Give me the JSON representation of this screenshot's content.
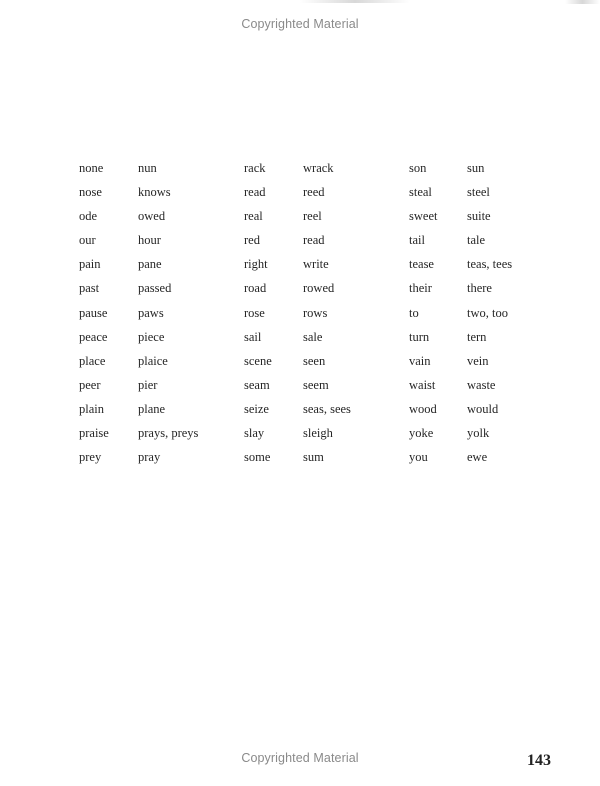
{
  "header": {
    "watermark": "Copyrighted Material"
  },
  "homophones": {
    "rows": [
      {
        "left": [
          "none",
          "nun"
        ],
        "middle": [
          "rack",
          "wrack"
        ],
        "right": [
          "son",
          "sun"
        ]
      },
      {
        "left": [
          "nose",
          "knows"
        ],
        "middle": [
          "read",
          "reed"
        ],
        "right": [
          "steal",
          "steel"
        ]
      },
      {
        "left": [
          "ode",
          "owed"
        ],
        "middle": [
          "real",
          "reel"
        ],
        "right": [
          "sweet",
          "suite"
        ]
      },
      {
        "left": [
          "our",
          "hour"
        ],
        "middle": [
          "red",
          "read"
        ],
        "right": [
          "tail",
          "tale"
        ]
      },
      {
        "left": [
          "pain",
          "pane"
        ],
        "middle": [
          "right",
          "write"
        ],
        "right": [
          "tease",
          "teas, tees"
        ]
      },
      {
        "left": [
          "past",
          "passed"
        ],
        "middle": [
          "road",
          "rowed"
        ],
        "right": [
          "their",
          "there"
        ]
      },
      {
        "left": [
          "pause",
          "paws"
        ],
        "middle": [
          "rose",
          "rows"
        ],
        "right": [
          "to",
          "two, too"
        ]
      },
      {
        "left": [
          "peace",
          "piece"
        ],
        "middle": [
          "sail",
          "sale"
        ],
        "right": [
          "turn",
          "tern"
        ]
      },
      {
        "left": [
          "place",
          "plaice"
        ],
        "middle": [
          "scene",
          "seen"
        ],
        "right": [
          "vain",
          "vein"
        ]
      },
      {
        "left": [
          "peer",
          "pier"
        ],
        "middle": [
          "seam",
          "seem"
        ],
        "right": [
          "waist",
          "waste"
        ]
      },
      {
        "left": [
          "plain",
          "plane"
        ],
        "middle": [
          "seize",
          "seas, sees"
        ],
        "right": [
          "wood",
          "would"
        ]
      },
      {
        "left": [
          "praise",
          "prays, preys"
        ],
        "middle": [
          "slay",
          "sleigh"
        ],
        "right": [
          "yoke",
          "yolk"
        ]
      },
      {
        "left": [
          "prey",
          "pray"
        ],
        "middle": [
          "some",
          "sum"
        ],
        "right": [
          "you",
          "ewe"
        ]
      }
    ]
  },
  "footer": {
    "watermark": "Copyrighted Material",
    "page_number": "143"
  }
}
